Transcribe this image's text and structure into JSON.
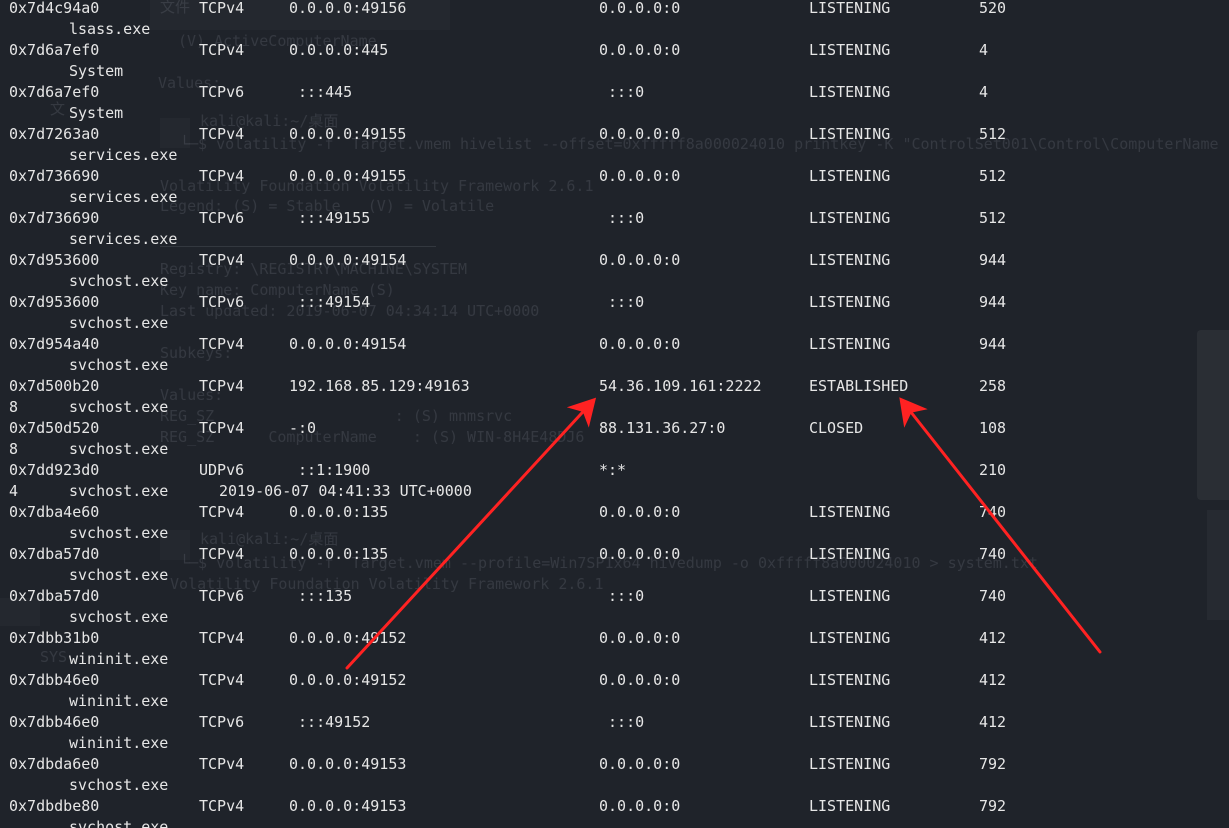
{
  "colors": {
    "background": "#1f232a",
    "text": "#e6e6e6",
    "annotation_arrow": "#ff2222"
  },
  "background_text": [
    "文件",
    "(V) ActiveComputerName",
    "Values:",
    "文",
    "kali@kali:~/桌面",
    "└─$ volatility -f  Target.vmem hivelist --offset=0xfffff8a000024010 printkey -K \"ControlSet001\\Control\\ComputerName",
    "Volatility Foundation Volatility Framework 2.6.1",
    "Legend: (S) = Stable   (V) = Volatile",
    "Registry: \\REGISTRY\\MACHINE\\SYSTEM",
    "Key name: ComputerName (S)",
    "Last updated: 2019-06-07 04:34:14 UTC+0000",
    "Subkeys:",
    "Values:",
    "REG_SZ                    : (S) mnmsrvc",
    "REG_SZ      ComputerName    : (S) WIN-8H4E48DJ6",
    "kali@kali:~/桌面",
    "└─$ volatility -f  Target.vmem --profile=Win7SP1x64 hivedump -o 0xfffff8a000024010 > system.txt",
    "Volatility Foundation Volatility Framework 2.6.1",
    "SYS"
  ],
  "connections": [
    {
      "offset": "0x7d4c94a0",
      "proto": "TCPv4",
      "local": "0.0.0.0:49156",
      "remote": "0.0.0.0:0",
      "state": "LISTENING",
      "pid": "520",
      "wrap": "",
      "owner": "lsass.exe",
      "created": ""
    },
    {
      "offset": "0x7d6a7ef0",
      "proto": "TCPv4",
      "local": "0.0.0.0:445",
      "remote": "0.0.0.0:0",
      "state": "LISTENING",
      "pid": "4",
      "wrap": "",
      "owner": "System",
      "created": ""
    },
    {
      "offset": "0x7d6a7ef0",
      "proto": "TCPv6",
      "local": " :::445",
      "remote": " :::0",
      "state": "LISTENING",
      "pid": "4",
      "wrap": "",
      "owner": "System",
      "created": ""
    },
    {
      "offset": "0x7d7263a0",
      "proto": "TCPv4",
      "local": "0.0.0.0:49155",
      "remote": "0.0.0.0:0",
      "state": "LISTENING",
      "pid": "512",
      "wrap": "",
      "owner": "services.exe",
      "created": ""
    },
    {
      "offset": "0x7d736690",
      "proto": "TCPv4",
      "local": "0.0.0.0:49155",
      "remote": "0.0.0.0:0",
      "state": "LISTENING",
      "pid": "512",
      "wrap": "",
      "owner": "services.exe",
      "created": ""
    },
    {
      "offset": "0x7d736690",
      "proto": "TCPv6",
      "local": " :::49155",
      "remote": " :::0",
      "state": "LISTENING",
      "pid": "512",
      "wrap": "",
      "owner": "services.exe",
      "created": ""
    },
    {
      "offset": "0x7d953600",
      "proto": "TCPv4",
      "local": "0.0.0.0:49154",
      "remote": "0.0.0.0:0",
      "state": "LISTENING",
      "pid": "944",
      "wrap": "",
      "owner": "svchost.exe",
      "created": ""
    },
    {
      "offset": "0x7d953600",
      "proto": "TCPv6",
      "local": " :::49154",
      "remote": " :::0",
      "state": "LISTENING",
      "pid": "944",
      "wrap": "",
      "owner": "svchost.exe",
      "created": ""
    },
    {
      "offset": "0x7d954a40",
      "proto": "TCPv4",
      "local": "0.0.0.0:49154",
      "remote": "0.0.0.0:0",
      "state": "LISTENING",
      "pid": "944",
      "wrap": "",
      "owner": "svchost.exe",
      "created": ""
    },
    {
      "offset": "0x7d500b20",
      "proto": "TCPv4",
      "local": "192.168.85.129:49163",
      "remote": "54.36.109.161:2222",
      "state": "ESTABLISHED",
      "pid": "258",
      "wrap": "8",
      "owner": "svchost.exe",
      "created": ""
    },
    {
      "offset": "0x7d50d520",
      "proto": "TCPv4",
      "local": "-:0",
      "remote": "88.131.36.27:0",
      "state": "CLOSED",
      "pid": "108",
      "wrap": "8",
      "owner": "svchost.exe",
      "created": ""
    },
    {
      "offset": "0x7dd923d0",
      "proto": "UDPv6",
      "local": " ::1:1900",
      "remote": "*:*",
      "state": "",
      "pid": "210",
      "wrap": "4",
      "owner": "svchost.exe",
      "created": "2019-06-07 04:41:33 UTC+0000"
    },
    {
      "offset": "0x7dba4e60",
      "proto": "TCPv4",
      "local": "0.0.0.0:135",
      "remote": "0.0.0.0:0",
      "state": "LISTENING",
      "pid": "740",
      "wrap": "",
      "owner": "svchost.exe",
      "created": ""
    },
    {
      "offset": "0x7dba57d0",
      "proto": "TCPv4",
      "local": "0.0.0.0:135",
      "remote": "0.0.0.0:0",
      "state": "LISTENING",
      "pid": "740",
      "wrap": "",
      "owner": "svchost.exe",
      "created": ""
    },
    {
      "offset": "0x7dba57d0",
      "proto": "TCPv6",
      "local": " :::135",
      "remote": " :::0",
      "state": "LISTENING",
      "pid": "740",
      "wrap": "",
      "owner": "svchost.exe",
      "created": ""
    },
    {
      "offset": "0x7dbb31b0",
      "proto": "TCPv4",
      "local": "0.0.0.0:49152",
      "remote": "0.0.0.0:0",
      "state": "LISTENING",
      "pid": "412",
      "wrap": "",
      "owner": "wininit.exe",
      "created": ""
    },
    {
      "offset": "0x7dbb46e0",
      "proto": "TCPv4",
      "local": "0.0.0.0:49152",
      "remote": "0.0.0.0:0",
      "state": "LISTENING",
      "pid": "412",
      "wrap": "",
      "owner": "wininit.exe",
      "created": ""
    },
    {
      "offset": "0x7dbb46e0",
      "proto": "TCPv6",
      "local": " :::49152",
      "remote": " :::0",
      "state": "LISTENING",
      "pid": "412",
      "wrap": "",
      "owner": "wininit.exe",
      "created": ""
    },
    {
      "offset": "0x7dbda6e0",
      "proto": "TCPv4",
      "local": "0.0.0.0:49153",
      "remote": "0.0.0.0:0",
      "state": "LISTENING",
      "pid": "792",
      "wrap": "",
      "owner": "svchost.exe",
      "created": ""
    },
    {
      "offset": "0x7dbdbe80",
      "proto": "TCPv4",
      "local": "0.0.0.0:49153",
      "remote": "0.0.0.0:0",
      "state": "LISTENING",
      "pid": "792",
      "wrap": "",
      "owner": "svchost.exe",
      "created": ""
    }
  ]
}
